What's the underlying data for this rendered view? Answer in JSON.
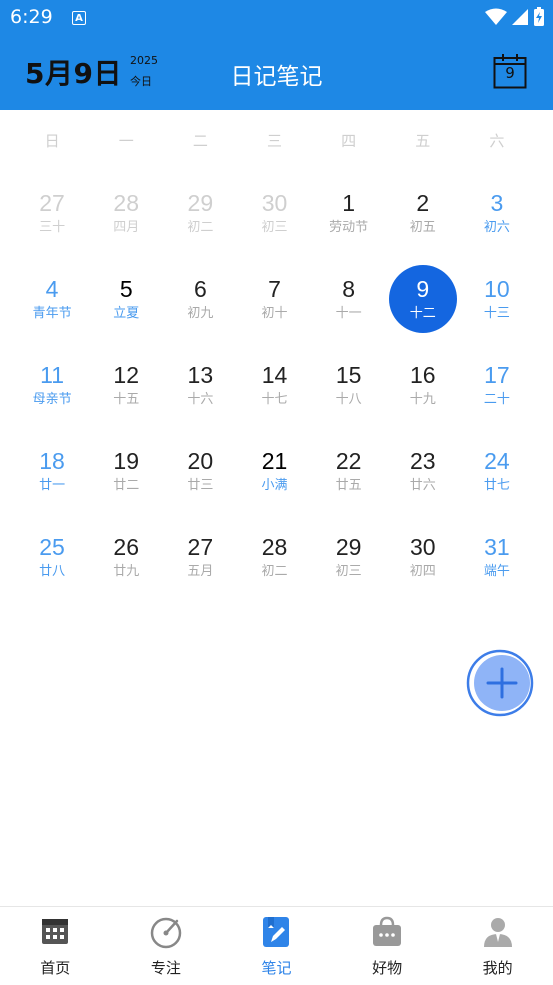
{
  "status_bar": {
    "time": "6:29",
    "notification_letter": "A"
  },
  "header": {
    "date": "5月9日",
    "year": "2025",
    "today_label": "今日",
    "title": "日记笔记",
    "calendar_icon_day": "9"
  },
  "weekdays": [
    "日",
    "一",
    "二",
    "三",
    "四",
    "五",
    "六"
  ],
  "calendar": {
    "weeks": [
      [
        {
          "day": "27",
          "sub": "三十",
          "style": "muted"
        },
        {
          "day": "28",
          "sub": "四月",
          "style": "muted"
        },
        {
          "day": "29",
          "sub": "初二",
          "style": "muted"
        },
        {
          "day": "30",
          "sub": "初三",
          "style": "muted"
        },
        {
          "day": "1",
          "sub": "劳动节",
          "style": "normal"
        },
        {
          "day": "2",
          "sub": "初五",
          "style": "normal"
        },
        {
          "day": "3",
          "sub": "初六",
          "style": "weekend"
        }
      ],
      [
        {
          "day": "4",
          "sub": "青年节",
          "style": "weekend"
        },
        {
          "day": "5",
          "sub": "立夏",
          "style": "festival"
        },
        {
          "day": "6",
          "sub": "初九",
          "style": "normal"
        },
        {
          "day": "7",
          "sub": "初十",
          "style": "normal"
        },
        {
          "day": "8",
          "sub": "十一",
          "style": "normal"
        },
        {
          "day": "9",
          "sub": "十二",
          "style": "selected"
        },
        {
          "day": "10",
          "sub": "十三",
          "style": "weekend"
        }
      ],
      [
        {
          "day": "11",
          "sub": "母亲节",
          "style": "weekend"
        },
        {
          "day": "12",
          "sub": "十五",
          "style": "normal"
        },
        {
          "day": "13",
          "sub": "十六",
          "style": "normal"
        },
        {
          "day": "14",
          "sub": "十七",
          "style": "normal"
        },
        {
          "day": "15",
          "sub": "十八",
          "style": "normal"
        },
        {
          "day": "16",
          "sub": "十九",
          "style": "normal"
        },
        {
          "day": "17",
          "sub": "二十",
          "style": "weekend"
        }
      ],
      [
        {
          "day": "18",
          "sub": "廿一",
          "style": "weekend"
        },
        {
          "day": "19",
          "sub": "廿二",
          "style": "normal"
        },
        {
          "day": "20",
          "sub": "廿三",
          "style": "normal"
        },
        {
          "day": "21",
          "sub": "小满",
          "style": "festival"
        },
        {
          "day": "22",
          "sub": "廿五",
          "style": "normal"
        },
        {
          "day": "23",
          "sub": "廿六",
          "style": "normal"
        },
        {
          "day": "24",
          "sub": "廿七",
          "style": "weekend"
        }
      ],
      [
        {
          "day": "25",
          "sub": "廿八",
          "style": "weekend"
        },
        {
          "day": "26",
          "sub": "廿九",
          "style": "normal"
        },
        {
          "day": "27",
          "sub": "五月",
          "style": "normal"
        },
        {
          "day": "28",
          "sub": "初二",
          "style": "normal"
        },
        {
          "day": "29",
          "sub": "初三",
          "style": "normal"
        },
        {
          "day": "30",
          "sub": "初四",
          "style": "normal"
        },
        {
          "day": "31",
          "sub": "端午",
          "style": "weekend"
        }
      ]
    ]
  },
  "fab": {
    "icon": "plus-icon"
  },
  "bottom_nav": [
    {
      "label": "首页",
      "icon": "calendar-grid-icon",
      "active": false
    },
    {
      "label": "专注",
      "icon": "focus-compass-icon",
      "active": false
    },
    {
      "label": "笔记",
      "icon": "notebook-pen-icon",
      "active": true
    },
    {
      "label": "好物",
      "icon": "shopping-bag-icon",
      "active": false
    },
    {
      "label": "我的",
      "icon": "user-profile-icon",
      "active": false
    }
  ],
  "colors": {
    "header_bg": "#1E88E5",
    "accent": "#2F84E8",
    "selected": "#1466E0",
    "weekend_text": "#4A9BEF",
    "muted_text": "#CFCFCF"
  }
}
